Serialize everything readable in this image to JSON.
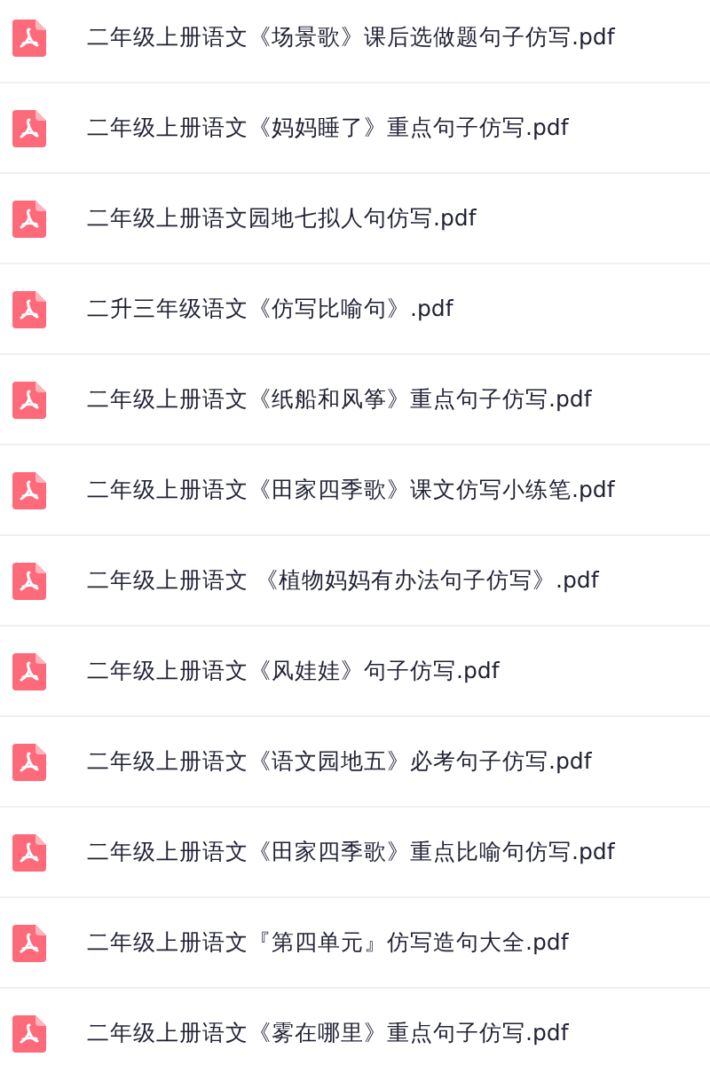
{
  "files": [
    {
      "name": "二年级上册语文《场景歌》课后选做题句子仿写.pdf",
      "kind": "pdf"
    },
    {
      "name": "二年级上册语文《妈妈睡了》重点句子仿写.pdf",
      "kind": "pdf"
    },
    {
      "name": "二年级上册语文园地七拟人句仿写.pdf",
      "kind": "pdf"
    },
    {
      "name": "二升三年级语文《仿写比喻句》.pdf",
      "kind": "pdf"
    },
    {
      "name": "二年级上册语文《纸船和风筝》重点句子仿写.pdf",
      "kind": "pdf"
    },
    {
      "name": "二年级上册语文《田家四季歌》课文仿写小练笔.pdf",
      "kind": "pdf"
    },
    {
      "name": "二年级上册语文 《植物妈妈有办法句子仿写》.pdf",
      "kind": "pdf"
    },
    {
      "name": "二年级上册语文《风娃娃》句子仿写.pdf",
      "kind": "pdf"
    },
    {
      "name": "二年级上册语文《语文园地五》必考句子仿写.pdf",
      "kind": "pdf"
    },
    {
      "name": "二年级上册语文《田家四季歌》重点比喻句仿写.pdf",
      "kind": "pdf"
    },
    {
      "name": "二年级上册语文『第四单元』仿写造句大全.pdf",
      "kind": "pdf"
    },
    {
      "name": "二年级上册语文《雾在哪里》重点句子仿写.pdf",
      "kind": "pdf"
    }
  ]
}
